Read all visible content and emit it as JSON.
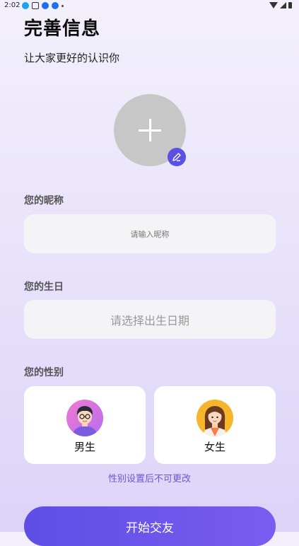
{
  "status_bar": {
    "time": "2:02"
  },
  "header": {
    "title": "完善信息",
    "subtitle": "让大家更好的认识你"
  },
  "nickname": {
    "label": "您的昵称",
    "placeholder": "请输入昵称"
  },
  "birthday": {
    "label": "您的生日",
    "placeholder": "请选择出生日期"
  },
  "gender": {
    "label": "您的性别",
    "options": [
      {
        "label": "男生"
      },
      {
        "label": "女生"
      }
    ],
    "note": "性别设置后不可更改"
  },
  "submit": {
    "label": "开始交友"
  },
  "colors": {
    "accent": "#5b50e6",
    "note": "#6b57d6",
    "avatar_placeholder": "#c7c7c7"
  }
}
